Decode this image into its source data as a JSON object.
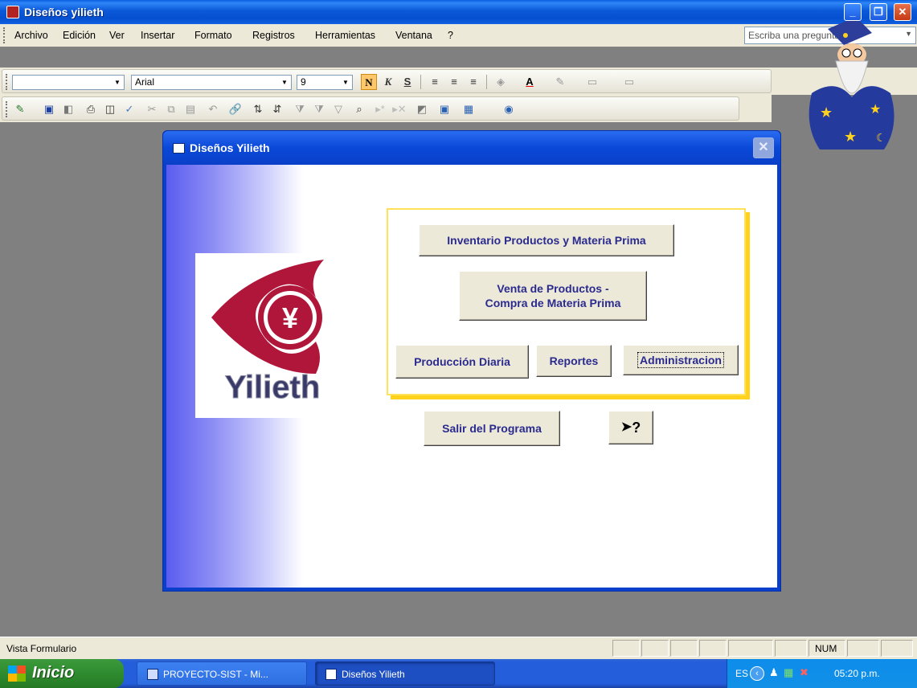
{
  "window": {
    "title": "Diseños yilieth"
  },
  "menu": {
    "items": [
      "Archivo",
      "Edición",
      "Ver",
      "Insertar",
      "Formato",
      "Registros",
      "Herramientas",
      "Ventana",
      "?"
    ],
    "ask_placeholder": "Escriba una pregunta"
  },
  "toolbar": {
    "font_name": "Arial",
    "font_size": "9",
    "bold": "N",
    "italic": "K",
    "underline": "S"
  },
  "form": {
    "title": "Diseños Yilieth",
    "logo_text": "Yilieth",
    "buttons": {
      "inventario": "Inventario Productos y Materia Prima",
      "venta_line1": "Venta de Productos -",
      "venta_line2": "Compra de Materia Prima",
      "produccion": "Producción Diaria",
      "reportes": "Reportes",
      "administracion": "Administracion",
      "salir": "Salir del Programa",
      "ayuda": "?"
    }
  },
  "statusbar": {
    "text": "Vista Formulario",
    "num": "NUM"
  },
  "taskbar": {
    "start": "Inicio",
    "tasks": [
      "PROYECTO-SIST - Mi...",
      "Diseños Yilieth"
    ],
    "lang": "ES",
    "time": "05:20 p.m."
  },
  "colors": {
    "accent": "#0a48d8",
    "button_text": "#2b2b8f",
    "frame": "#ffd21e",
    "logo": "#b0163a"
  }
}
